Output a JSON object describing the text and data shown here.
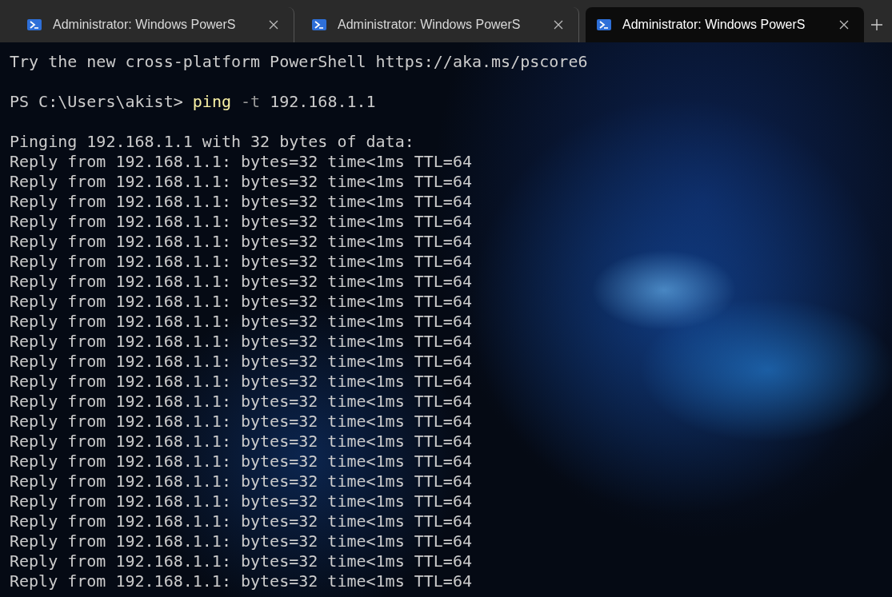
{
  "tabs": [
    {
      "title": "Administrator: Windows PowerS",
      "selected": false
    },
    {
      "title": "Administrator: Windows PowerS",
      "selected": false
    },
    {
      "title": "Administrator: Windows PowerS",
      "selected": true
    }
  ],
  "terminal": {
    "banner": "Try the new cross-platform PowerShell https://aka.ms/pscore6",
    "prompt": {
      "path": "PS C:\\Users\\akist>",
      "command": "ping",
      "args": [
        {
          "kind": "flag",
          "text": "-t"
        },
        {
          "kind": "value",
          "text": "192.168.1.1"
        }
      ]
    },
    "output": [
      "Pinging 192.168.1.1 with 32 bytes of data:",
      "Reply from 192.168.1.1: bytes=32 time<1ms TTL=64",
      "Reply from 192.168.1.1: bytes=32 time<1ms TTL=64",
      "Reply from 192.168.1.1: bytes=32 time<1ms TTL=64",
      "Reply from 192.168.1.1: bytes=32 time<1ms TTL=64",
      "Reply from 192.168.1.1: bytes=32 time<1ms TTL=64",
      "Reply from 192.168.1.1: bytes=32 time<1ms TTL=64",
      "Reply from 192.168.1.1: bytes=32 time<1ms TTL=64",
      "Reply from 192.168.1.1: bytes=32 time<1ms TTL=64",
      "Reply from 192.168.1.1: bytes=32 time<1ms TTL=64",
      "Reply from 192.168.1.1: bytes=32 time<1ms TTL=64",
      "Reply from 192.168.1.1: bytes=32 time<1ms TTL=64",
      "Reply from 192.168.1.1: bytes=32 time<1ms TTL=64",
      "Reply from 192.168.1.1: bytes=32 time<1ms TTL=64",
      "Reply from 192.168.1.1: bytes=32 time<1ms TTL=64",
      "Reply from 192.168.1.1: bytes=32 time<1ms TTL=64",
      "Reply from 192.168.1.1: bytes=32 time<1ms TTL=64",
      "Reply from 192.168.1.1: bytes=32 time<1ms TTL=64",
      "Reply from 192.168.1.1: bytes=32 time<1ms TTL=64",
      "Reply from 192.168.1.1: bytes=32 time<1ms TTL=64",
      "Reply from 192.168.1.1: bytes=32 time<1ms TTL=64",
      "Reply from 192.168.1.1: bytes=32 time<1ms TTL=64",
      "Reply from 192.168.1.1: bytes=32 time<1ms TTL=64"
    ]
  }
}
